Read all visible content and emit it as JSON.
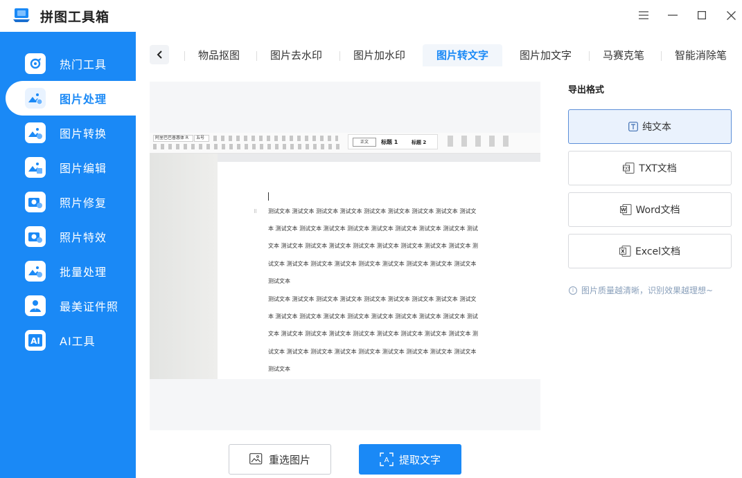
{
  "app": {
    "title": "拼图工具箱"
  },
  "sidebar": {
    "items": [
      {
        "label": "热门工具",
        "icon": "tools-icon"
      },
      {
        "label": "图片处理",
        "icon": "image-process-icon",
        "active": true
      },
      {
        "label": "图片转换",
        "icon": "image-convert-icon"
      },
      {
        "label": "图片编辑",
        "icon": "image-edit-icon"
      },
      {
        "label": "照片修复",
        "icon": "photo-repair-icon"
      },
      {
        "label": "照片特效",
        "icon": "photo-effect-icon"
      },
      {
        "label": "批量处理",
        "icon": "batch-icon"
      },
      {
        "label": "最美证件照",
        "icon": "id-photo-icon"
      },
      {
        "label": "AI工具",
        "icon": "ai-icon"
      }
    ]
  },
  "tabs": {
    "items": [
      {
        "label": "物品抠图"
      },
      {
        "label": "图片去水印"
      },
      {
        "label": "图片加水印"
      },
      {
        "label": "图片转文字",
        "active": true
      },
      {
        "label": "图片加文字"
      },
      {
        "label": "马赛克笔"
      },
      {
        "label": "智能消除笔"
      }
    ]
  },
  "document": {
    "ribbon": {
      "font": "阿里巴巴普惠体 R",
      "size": "五号",
      "style_normal": "正文",
      "style_h1": "标题 1",
      "style_h2": "标题 2"
    },
    "lines": [
      "测试文本 测试文本 测试文本 测试文本 测试文本 测试文本 测试文本 测试文本 测试文",
      "本 测试文本 测试文本 测试文本 测试文本 测试文本 测试文本 测试文本 测试文本 测试",
      "文本 测试文本 测试文本 测试文本 测试文本 测试文本 测试文本 测试文本 测试文本 测",
      "试文本 测试文本 测试文本 测试文本 测试文本 测试文本 测试文本 测试文本 测试文本",
      "测试文本",
      "测试文本 测试文本 测试文本 测试文本 测试文本 测试文本 测试文本 测试文本 测试文",
      "本 测试文本 测试文本 测试文本 测试文本 测试文本 测试文本 测试文本 测试文本 测试",
      "文本 测试文本 测试文本 测试文本 测试文本 测试文本 测试文本 测试文本 测试文本 测",
      "试文本 测试文本 测试文本 测试文本 测试文本 测试文本 测试文本 测试文本 测试文本",
      "测试文本"
    ]
  },
  "export": {
    "title": "导出格式",
    "formats": [
      {
        "label": "纯文本",
        "icon": "text-icon",
        "selected": true
      },
      {
        "label": "TXT文档",
        "icon": "txt-file-icon"
      },
      {
        "label": "Word文档",
        "icon": "word-file-icon"
      },
      {
        "label": "Excel文档",
        "icon": "excel-file-icon"
      }
    ],
    "tip": "图片质量越清晰，识别效果越理想~"
  },
  "actions": {
    "reselect": "重选图片",
    "extract": "提取文字"
  },
  "colors": {
    "accent": "#1a89f6",
    "selected_bg": "#eaf2fd"
  }
}
